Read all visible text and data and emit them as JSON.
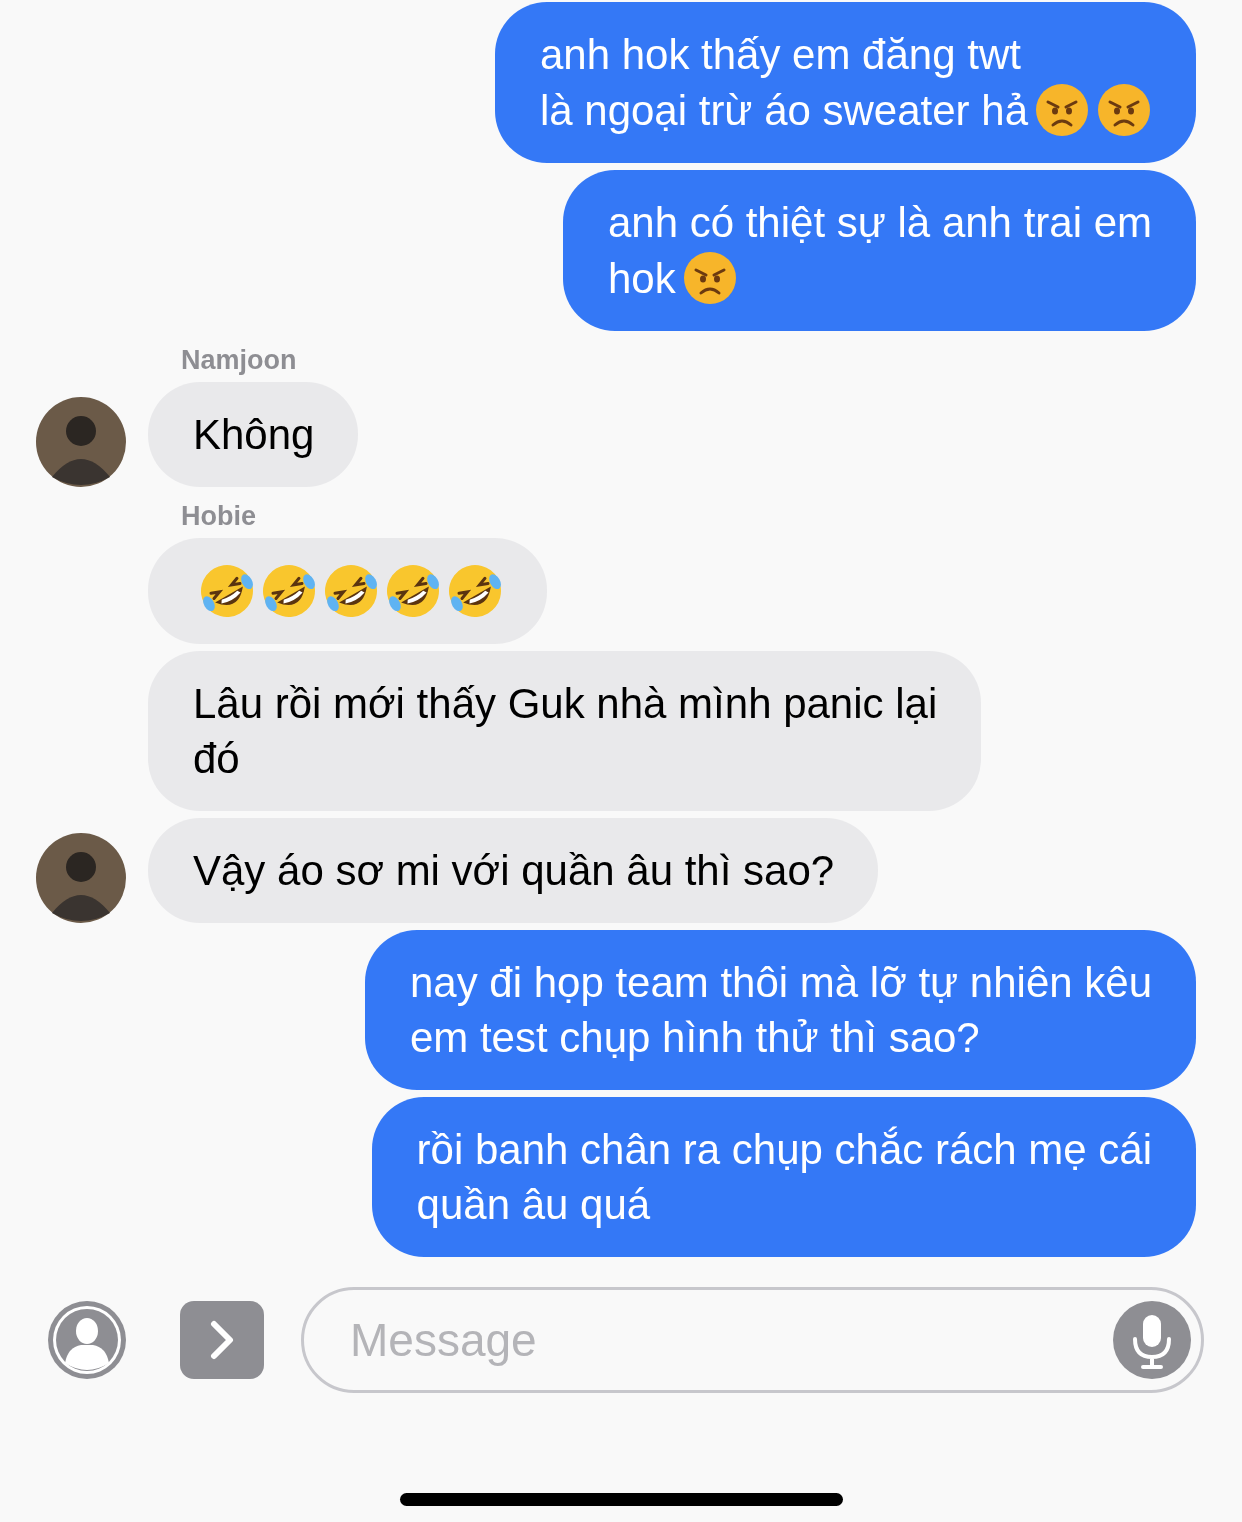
{
  "messages": [
    {
      "kind": "sent",
      "lines": [
        "anh hok thấy em đăng twt",
        "là ngoại trừ áo sweater hả"
      ],
      "emoji": [
        {
          "kind": "angry"
        },
        {
          "kind": "angry"
        }
      ]
    },
    {
      "kind": "sent",
      "lines": [
        "anh có thiệt sự là anh trai em",
        "hok"
      ],
      "emoji": [
        {
          "kind": "angry"
        }
      ]
    },
    {
      "kind": "received",
      "sender": "Namjoon",
      "lines": [
        "Không"
      ],
      "avatar": true
    },
    {
      "kind": "received",
      "sender": "Hobie",
      "emoji": [
        {
          "kind": "rofl"
        },
        {
          "kind": "rofl"
        },
        {
          "kind": "rofl"
        },
        {
          "kind": "rofl"
        },
        {
          "kind": "rofl"
        }
      ]
    },
    {
      "kind": "received",
      "lines": [
        "Lâu rồi mới thấy Guk nhà mình panic lại",
        "đó"
      ]
    },
    {
      "kind": "received",
      "lines": [
        "Vậy áo sơ mi với quần âu thì sao?"
      ],
      "avatar": true
    },
    {
      "kind": "sent",
      "lines": [
        "nay đi họp team thôi mà lỡ tự nhiên kêu",
        "em test chụp hình thử thì sao?"
      ]
    },
    {
      "kind": "sent",
      "lines": [
        "rồi banh chân ra chụp chắc rách mẹ cái",
        "quần âu quá"
      ]
    }
  ],
  "composer": {
    "placeholder": "Message"
  }
}
